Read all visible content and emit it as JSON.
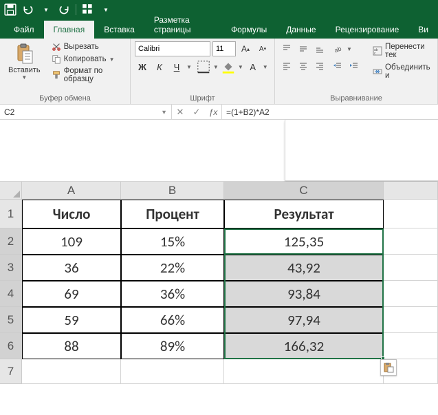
{
  "qat": {
    "save_tip": "Save",
    "undo_tip": "Undo",
    "redo_tip": "Redo",
    "customize_tip": "Customize"
  },
  "tabs": {
    "file": "Файл",
    "home": "Главная",
    "insert": "Вставка",
    "pagelayout": "Разметка страницы",
    "formulas": "Формулы",
    "data": "Данные",
    "review": "Рецензирование",
    "view": "Ви"
  },
  "ribbon": {
    "clipboard": {
      "paste": "Вставить",
      "cut": "Вырезать",
      "copy": "Копировать",
      "format_painter": "Формат по образцу",
      "label": "Буфер обмена"
    },
    "font": {
      "name": "Calibri",
      "size": "11",
      "bold": "Ж",
      "italic": "К",
      "underline": "Ч",
      "label": "Шрифт"
    },
    "alignment": {
      "wrap": "Перенести тек",
      "merge": "Объединить и",
      "label": "Выравнивание"
    }
  },
  "namebox": "C2",
  "formula": "=(1+B2)*A2",
  "columns": [
    "A",
    "B",
    "C"
  ],
  "rows": [
    "1",
    "2",
    "3",
    "4",
    "5",
    "6",
    "7"
  ],
  "table": {
    "headers": {
      "A": "Число",
      "B": "Процент",
      "C": "Результат"
    },
    "data": [
      {
        "A": "109",
        "B": "15%",
        "C": "125,35"
      },
      {
        "A": "36",
        "B": "22%",
        "C": "43,92"
      },
      {
        "A": "69",
        "B": "36%",
        "C": "93,84"
      },
      {
        "A": "59",
        "B": "66%",
        "C": "97,94"
      },
      {
        "A": "88",
        "B": "89%",
        "C": "166,32"
      }
    ]
  },
  "chart_data": {
    "type": "table",
    "title": "",
    "columns": [
      "Число",
      "Процент",
      "Результат"
    ],
    "rows": [
      [
        109,
        0.15,
        125.35
      ],
      [
        36,
        0.22,
        43.92
      ],
      [
        69,
        0.36,
        93.84
      ],
      [
        59,
        0.66,
        97.94
      ],
      [
        88,
        0.89,
        166.32
      ]
    ],
    "formula": "Результат = (1 + Процент) * Число"
  }
}
